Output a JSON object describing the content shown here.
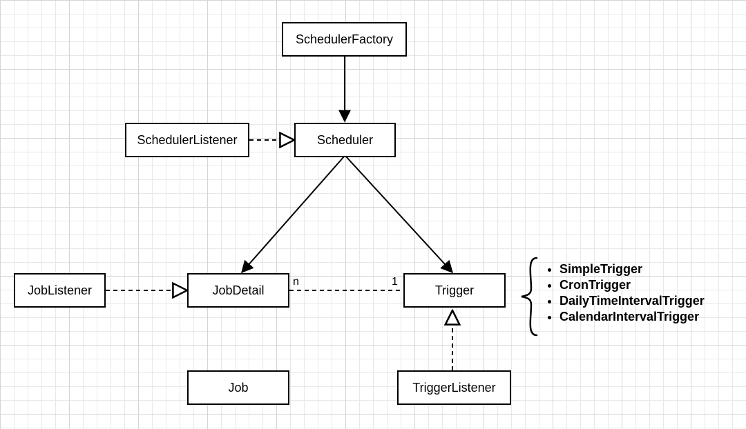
{
  "nodes": {
    "schedulerFactory": "SchedulerFactory",
    "schedulerListener": "SchedulerListener",
    "scheduler": "Scheduler",
    "jobListener": "JobListener",
    "jobDetail": "JobDetail",
    "trigger": "Trigger",
    "job": "Job",
    "triggerListener": "TriggerListener"
  },
  "multiplicities": {
    "jobDetailSide": "n",
    "triggerSide": "1"
  },
  "triggerTypes": [
    "SimpleTrigger",
    "CronTrigger",
    "DailyTimeIntervalTrigger",
    "CalendarIntervalTrigger"
  ]
}
